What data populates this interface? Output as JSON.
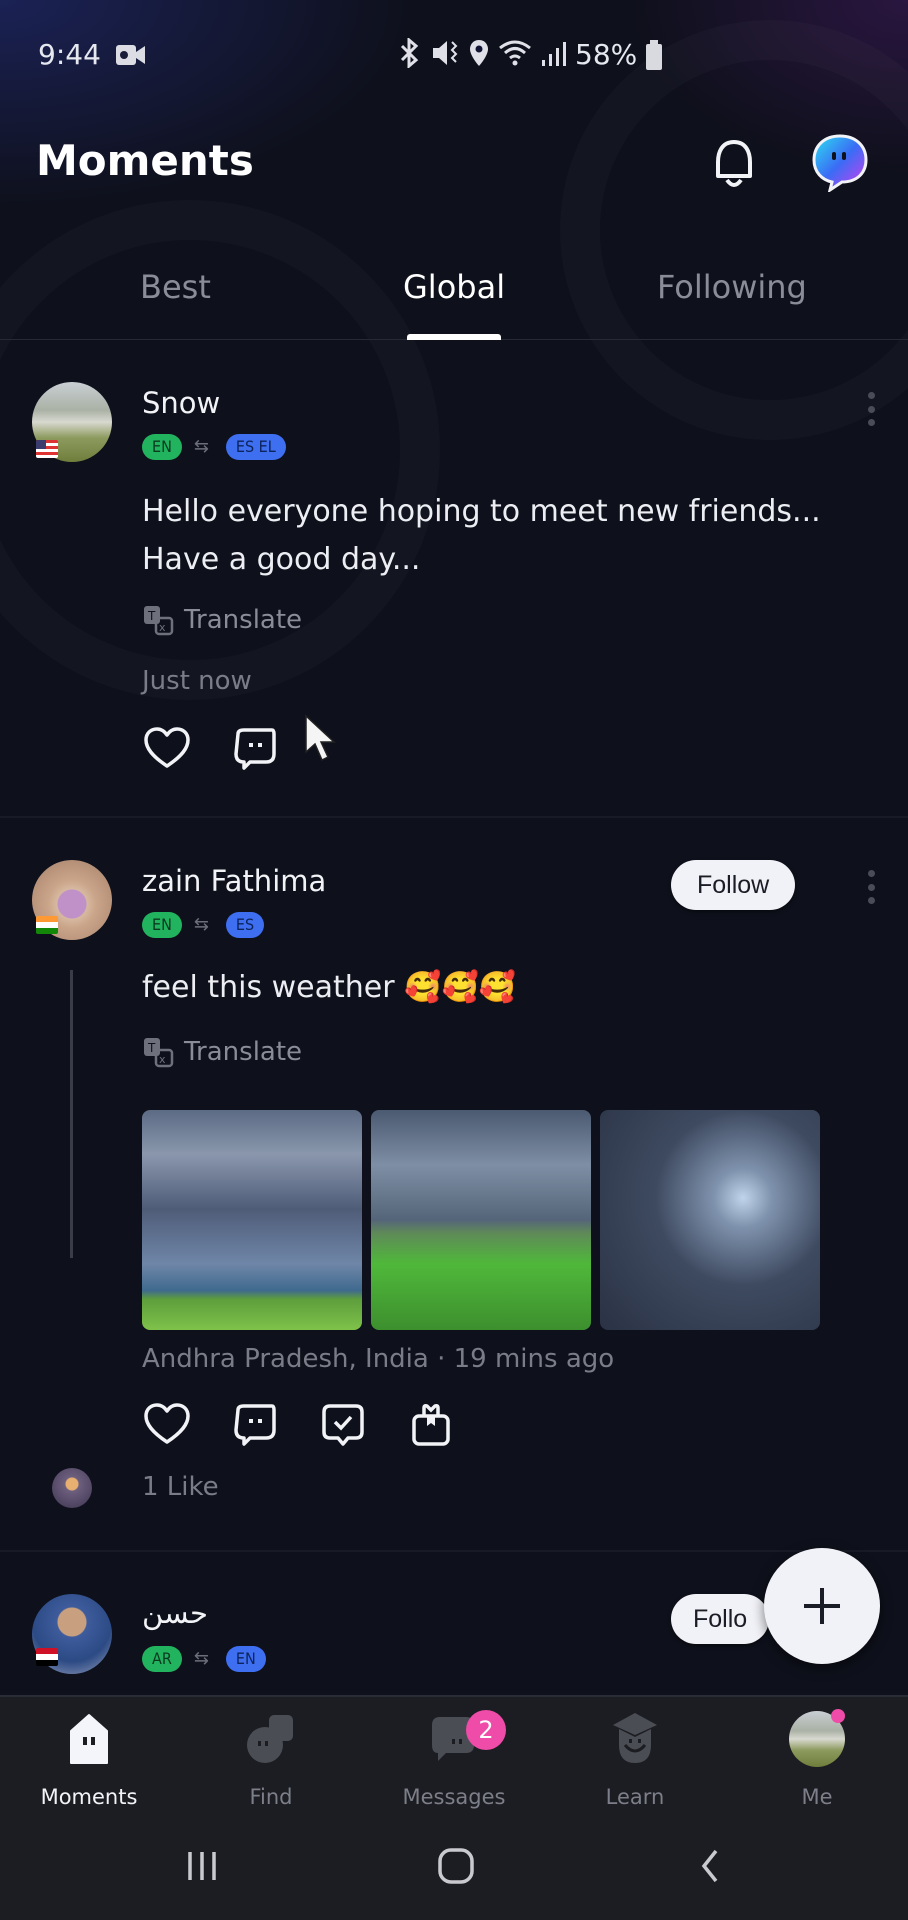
{
  "status_bar": {
    "time": "9:44",
    "battery": "58%",
    "icons": [
      "video-recording-icon",
      "bluetooth-icon",
      "vibrate-icon",
      "location-icon",
      "wifi-icon",
      "signal-icon",
      "battery-icon"
    ]
  },
  "header": {
    "title": "Moments",
    "notifications_icon": "bell-icon",
    "assistant_icon": "chat-bubble-logo-icon"
  },
  "tabs": [
    {
      "label": "Best",
      "active": false
    },
    {
      "label": "Global",
      "active": true
    },
    {
      "label": "Following",
      "active": false
    }
  ],
  "posts": [
    {
      "username": "Snow",
      "flag": "US",
      "native_langs": [
        "EN"
      ],
      "learning_langs": "ES  EL",
      "text_line1": "Hello everyone hoping to meet new friends...",
      "text_line2": "Have a good day...",
      "translate_label": "Translate",
      "meta": "Just now",
      "actions": [
        "like",
        "comment"
      ]
    },
    {
      "username": "zain Fathima",
      "flag": "IN",
      "native_langs": [
        "EN"
      ],
      "learning_langs": "ES",
      "follow_label": "Follow",
      "text": "feel this weather 🥰🥰🥰",
      "translate_label": "Translate",
      "images": [
        "stormy-clouds-field",
        "clouds-over-green-cliff",
        "mammatus-clouds"
      ],
      "meta": "Andhra Pradesh, India · 19 mins ago",
      "actions": [
        "like",
        "comment",
        "correct",
        "gift"
      ],
      "likes": "1 Like"
    },
    {
      "username": "حسن",
      "flag": "EG",
      "native_langs": [
        "AR"
      ],
      "learning_langs": "EN",
      "follow_label": "Follo"
    }
  ],
  "fab": {
    "icon": "plus-icon"
  },
  "bottom_nav": [
    {
      "label": "Moments",
      "icon": "moments-icon",
      "active": true
    },
    {
      "label": "Find",
      "icon": "find-icon",
      "active": false
    },
    {
      "label": "Messages",
      "icon": "messages-icon",
      "active": false,
      "badge": "2"
    },
    {
      "label": "Learn",
      "icon": "learn-icon",
      "active": false
    },
    {
      "label": "Me",
      "icon": "profile-avatar",
      "active": false,
      "dot": true
    }
  ],
  "colors": {
    "background": "#0e101b",
    "native_lang": "#22b35e",
    "learning_lang": "#3d6ff0",
    "badge": "#ef4ba8"
  }
}
